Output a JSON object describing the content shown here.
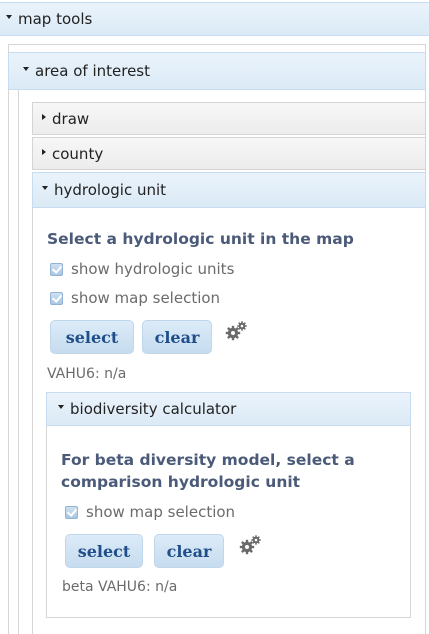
{
  "map_tools": {
    "label": "map tools"
  },
  "area_of_interest": {
    "label": "area of interest"
  },
  "panels": {
    "draw": {
      "label": "draw"
    },
    "county": {
      "label": "county"
    },
    "hydrologic_unit": {
      "label": "hydrologic unit",
      "heading": "Select a hydrologic unit in the map",
      "show_units_label": "show hydrologic units",
      "show_units_checked": true,
      "show_selection_label": "show map selection",
      "show_selection_checked": true,
      "select_label": "select",
      "clear_label": "clear",
      "settings_icon": "gears-icon",
      "status": "VAHU6: n/a"
    }
  },
  "biodiversity": {
    "label": "biodiversity calculator",
    "heading_line1": "For beta diversity model, select a",
    "heading_line2": "comparison hydrologic unit",
    "show_selection_label": "show map selection",
    "show_selection_checked": true,
    "select_label": "select",
    "clear_label": "clear",
    "settings_icon": "gears-icon",
    "status": "beta VAHU6: n/a"
  },
  "colors": {
    "header_blue": "#dbeaf6",
    "header_gray": "#ececec",
    "heading_text": "#4a5a78",
    "button_text": "#1f4e8a"
  }
}
